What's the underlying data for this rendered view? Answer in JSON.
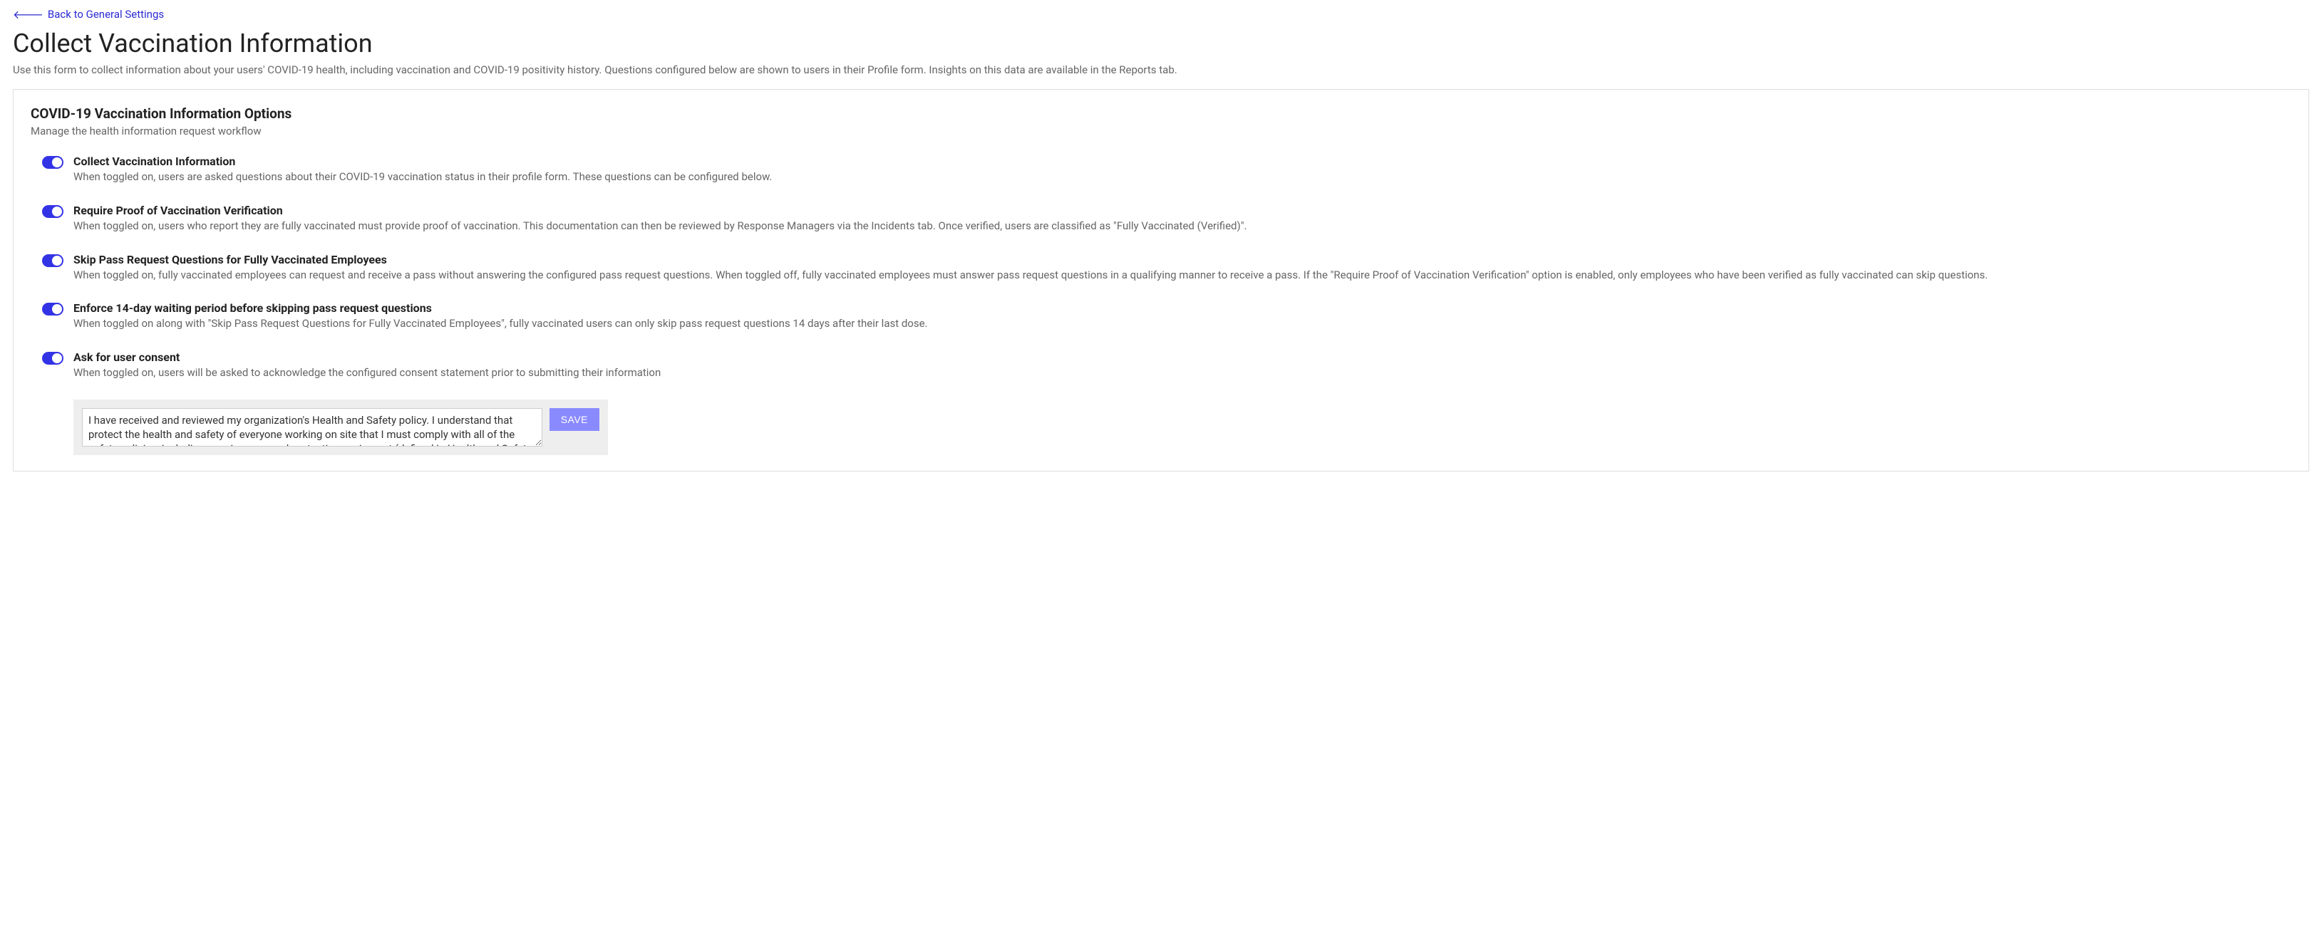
{
  "back_link": {
    "label": "Back to General Settings"
  },
  "page": {
    "title": "Collect Vaccination Information",
    "subtitle": "Use this form to collect information about your users' COVID-19 health, including vaccination and COVID-19 positivity history. Questions configured below are shown to users in their Profile form. Insights on this data are available in the Reports tab."
  },
  "panel": {
    "title": "COVID-19 Vaccination Information Options",
    "subtitle": "Manage the health information request workflow"
  },
  "options": {
    "collect": {
      "title": "Collect Vaccination Information",
      "desc": "When toggled on, users are asked questions about their COVID-19 vaccination status in their profile form. These questions can be configured below.",
      "on": true
    },
    "proof": {
      "title": "Require Proof of Vaccination Verification",
      "desc": "When toggled on, users who report they are fully vaccinated must provide proof of vaccination. This documentation can then be reviewed by Response Managers via the Incidents tab. Once verified, users are classified as \"Fully Vaccinated (Verified)\".",
      "on": true
    },
    "skip": {
      "title": "Skip Pass Request Questions for Fully Vaccinated Employees",
      "desc": "When toggled on, fully vaccinated employees can request and receive a pass without answering the configured pass request questions. When toggled off, fully vaccinated employees must answer pass request questions in a qualifying manner to receive a pass. If the \"Require Proof of Vaccination Verification\" option is enabled, only employees who have been verified as fully vaccinated can skip questions.",
      "on": true
    },
    "wait14": {
      "title": "Enforce 14-day waiting period before skipping pass request questions",
      "desc": "When toggled on along with \"Skip Pass Request Questions for Fully Vaccinated Employees\", fully vaccinated users can only skip pass request questions 14 days after their last dose.",
      "on": true
    },
    "consent": {
      "title": "Ask for user consent",
      "desc": "When toggled on, users will be asked to acknowledge the configured consent statement prior to submitting their information",
      "on": true,
      "value": "I have received and reviewed my organization's Health and Safety policy. I understand that protect the health and safety of everyone working on site that I must comply with all of the safety policies, including wearing personal protective equipment (defined in Health and Safety policy) at all times",
      "save_label": "SAVE"
    }
  }
}
